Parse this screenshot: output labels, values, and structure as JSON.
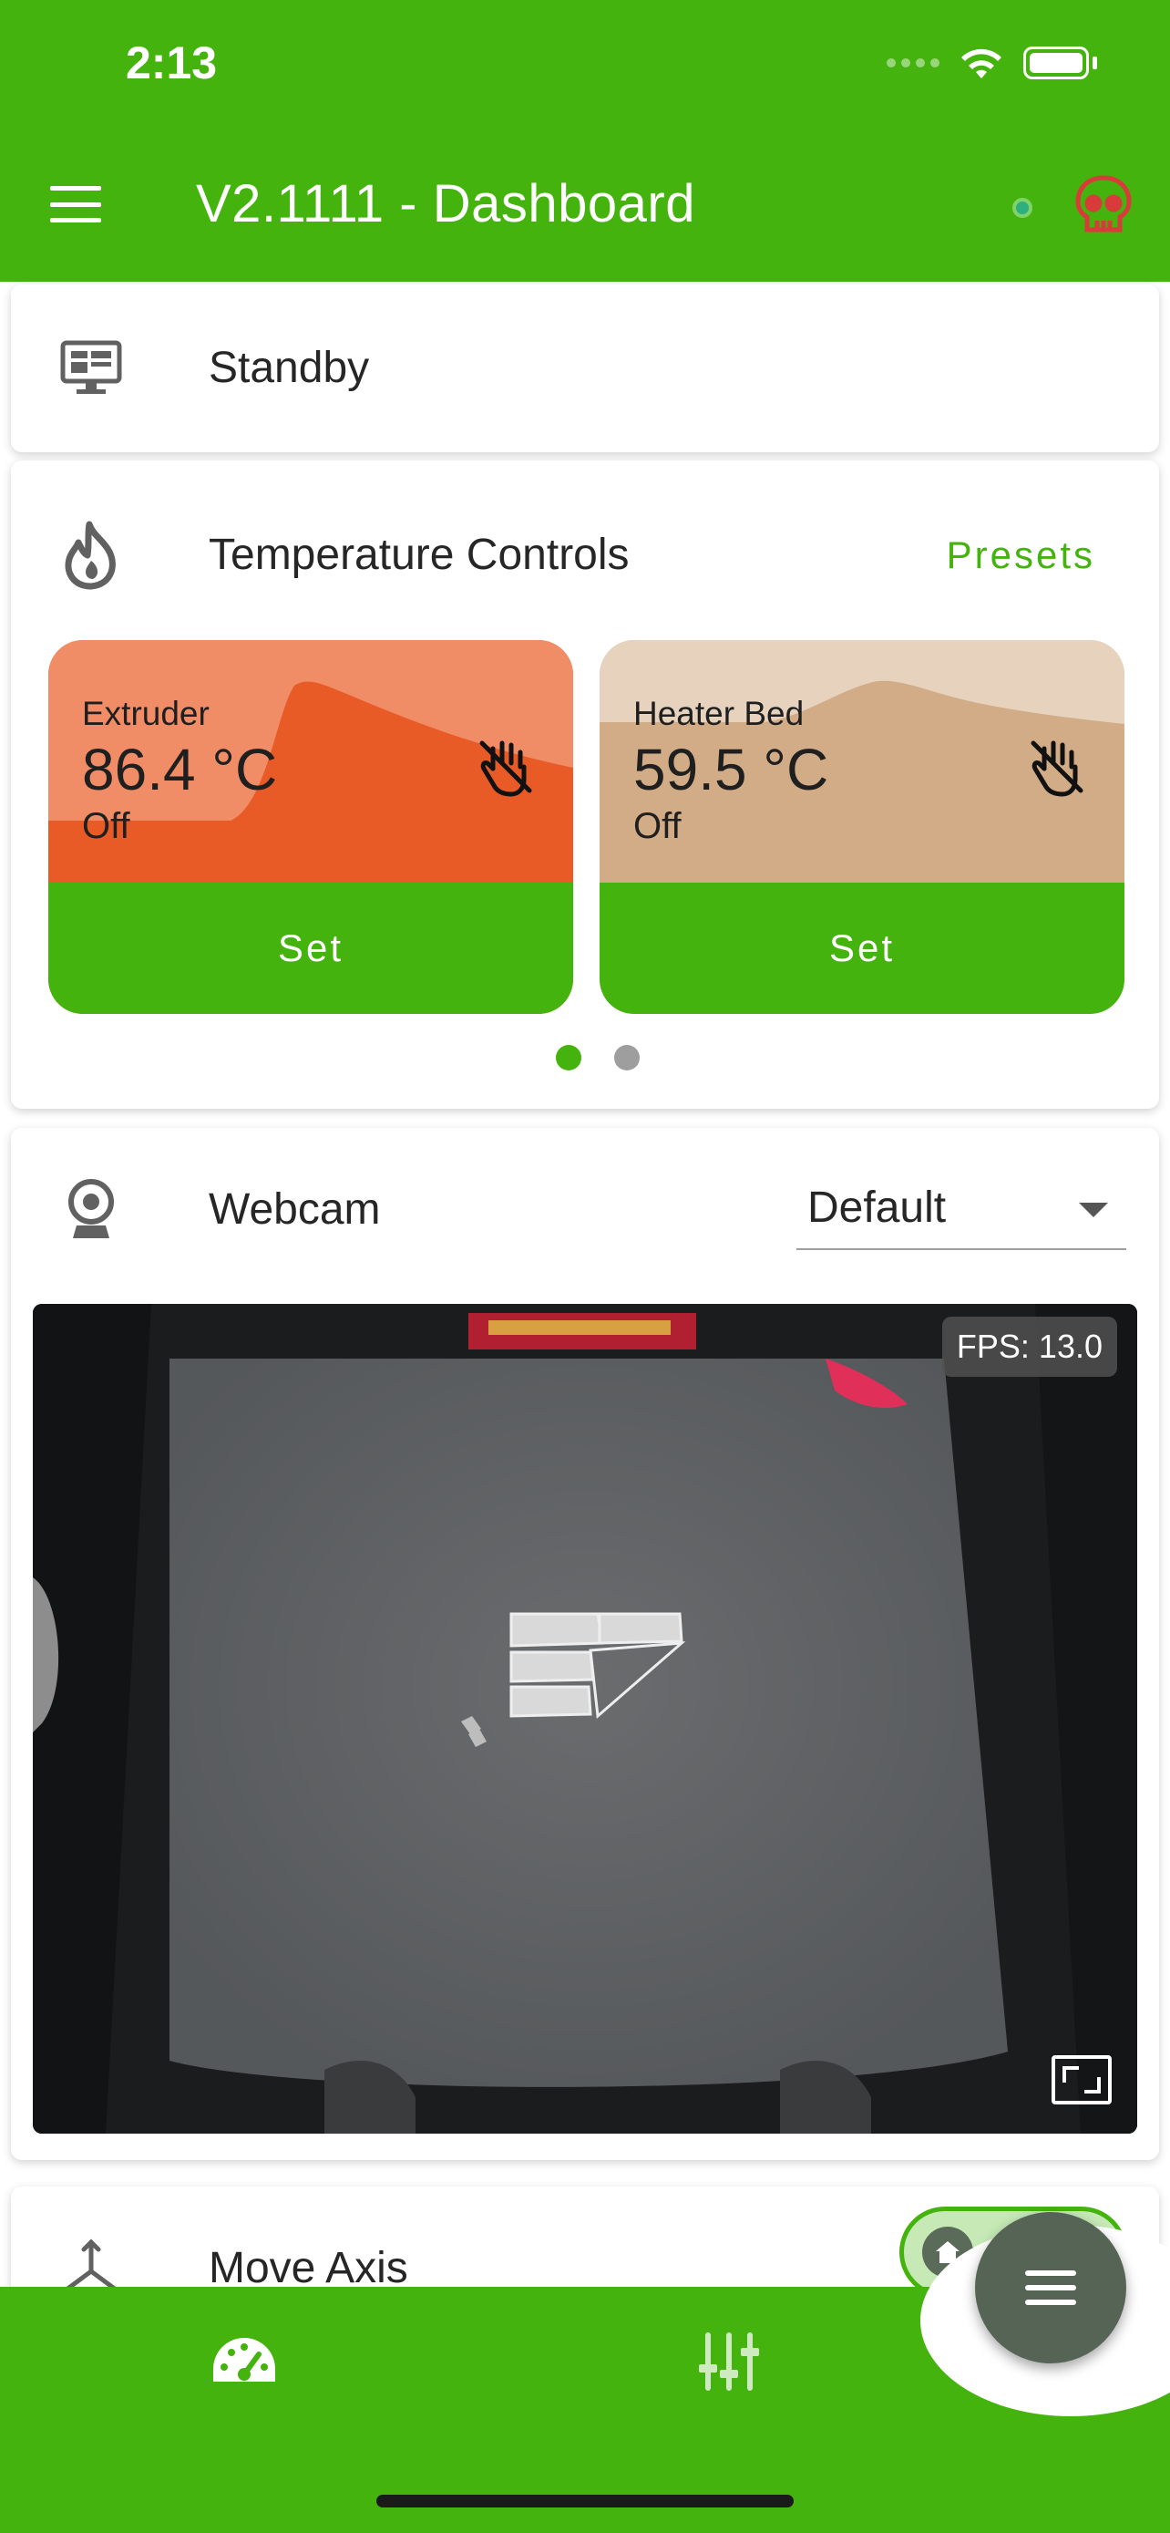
{
  "status_bar": {
    "time": "2:13"
  },
  "app_bar": {
    "title": "V2.1111 - Dashboard"
  },
  "standby_card": {
    "title": "Standby"
  },
  "temperature_card": {
    "title": "Temperature Controls",
    "presets_label": "Presets",
    "heaters": [
      {
        "label": "Extruder",
        "value": "86.4 °C",
        "state": "Off",
        "set_label": "Set",
        "color": "#e85a26"
      },
      {
        "label": "Heater Bed",
        "value": "59.5 °C",
        "state": "Off",
        "set_label": "Set",
        "color": "#d1ac86"
      }
    ],
    "pager": {
      "pages": 2,
      "active": 1
    }
  },
  "webcam_card": {
    "title": "Webcam",
    "selected_camera": "Default",
    "fps": "FPS: 13.0"
  },
  "move_axis_card": {
    "title": "Move Axis"
  },
  "colors": {
    "accent": "#45b30e",
    "fab": "#566455",
    "error": "#d93a3a"
  },
  "icons": {
    "menu": "menu-icon",
    "connection": "connection-status-dot",
    "emergency": "skull-icon",
    "standby": "monitor-icon",
    "temperature": "flame-icon",
    "heater_off": "hand-off-icon",
    "webcam": "webcam-icon",
    "fullscreen": "fullscreen-icon",
    "move_axis": "axis-icon",
    "home": "home-icon",
    "dashboard": "speedometer-icon",
    "controls": "sliders-icon",
    "fab": "menu-icon"
  }
}
